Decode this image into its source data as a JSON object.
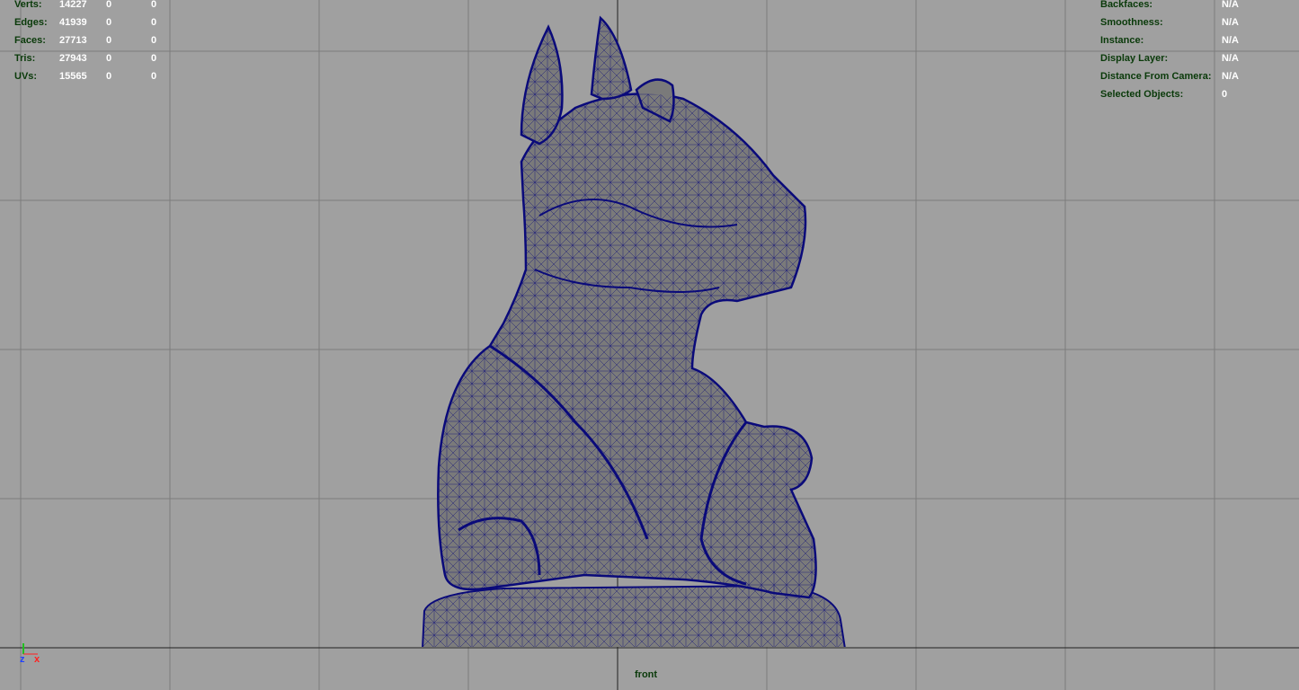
{
  "viewport": {
    "camera_name": "front",
    "background_color": "#a0a0a0",
    "wireframe_color": "#0a0a7a",
    "model_icon": "wireframe-rhino-statue"
  },
  "poly_count": {
    "rows": [
      {
        "label": "Verts:",
        "values": [
          "14227",
          "0",
          "0"
        ]
      },
      {
        "label": "Edges:",
        "values": [
          "41939",
          "0",
          "0"
        ]
      },
      {
        "label": "Faces:",
        "values": [
          "27713",
          "0",
          "0"
        ]
      },
      {
        "label": "Tris:",
        "values": [
          "27943",
          "0",
          "0"
        ]
      },
      {
        "label": "UVs:",
        "values": [
          "15565",
          "0",
          "0"
        ]
      }
    ]
  },
  "object_details": {
    "rows": [
      {
        "label": "Backfaces:",
        "value": "N/A"
      },
      {
        "label": "Smoothness:",
        "value": "N/A"
      },
      {
        "label": "Instance:",
        "value": "N/A"
      },
      {
        "label": "Display Layer:",
        "value": "N/A"
      },
      {
        "label": "Distance From Camera:",
        "value": "N/A"
      },
      {
        "label": "Selected Objects:",
        "value": "0"
      }
    ]
  },
  "axis_indicator": {
    "z_label": "z",
    "x_label": "x"
  }
}
